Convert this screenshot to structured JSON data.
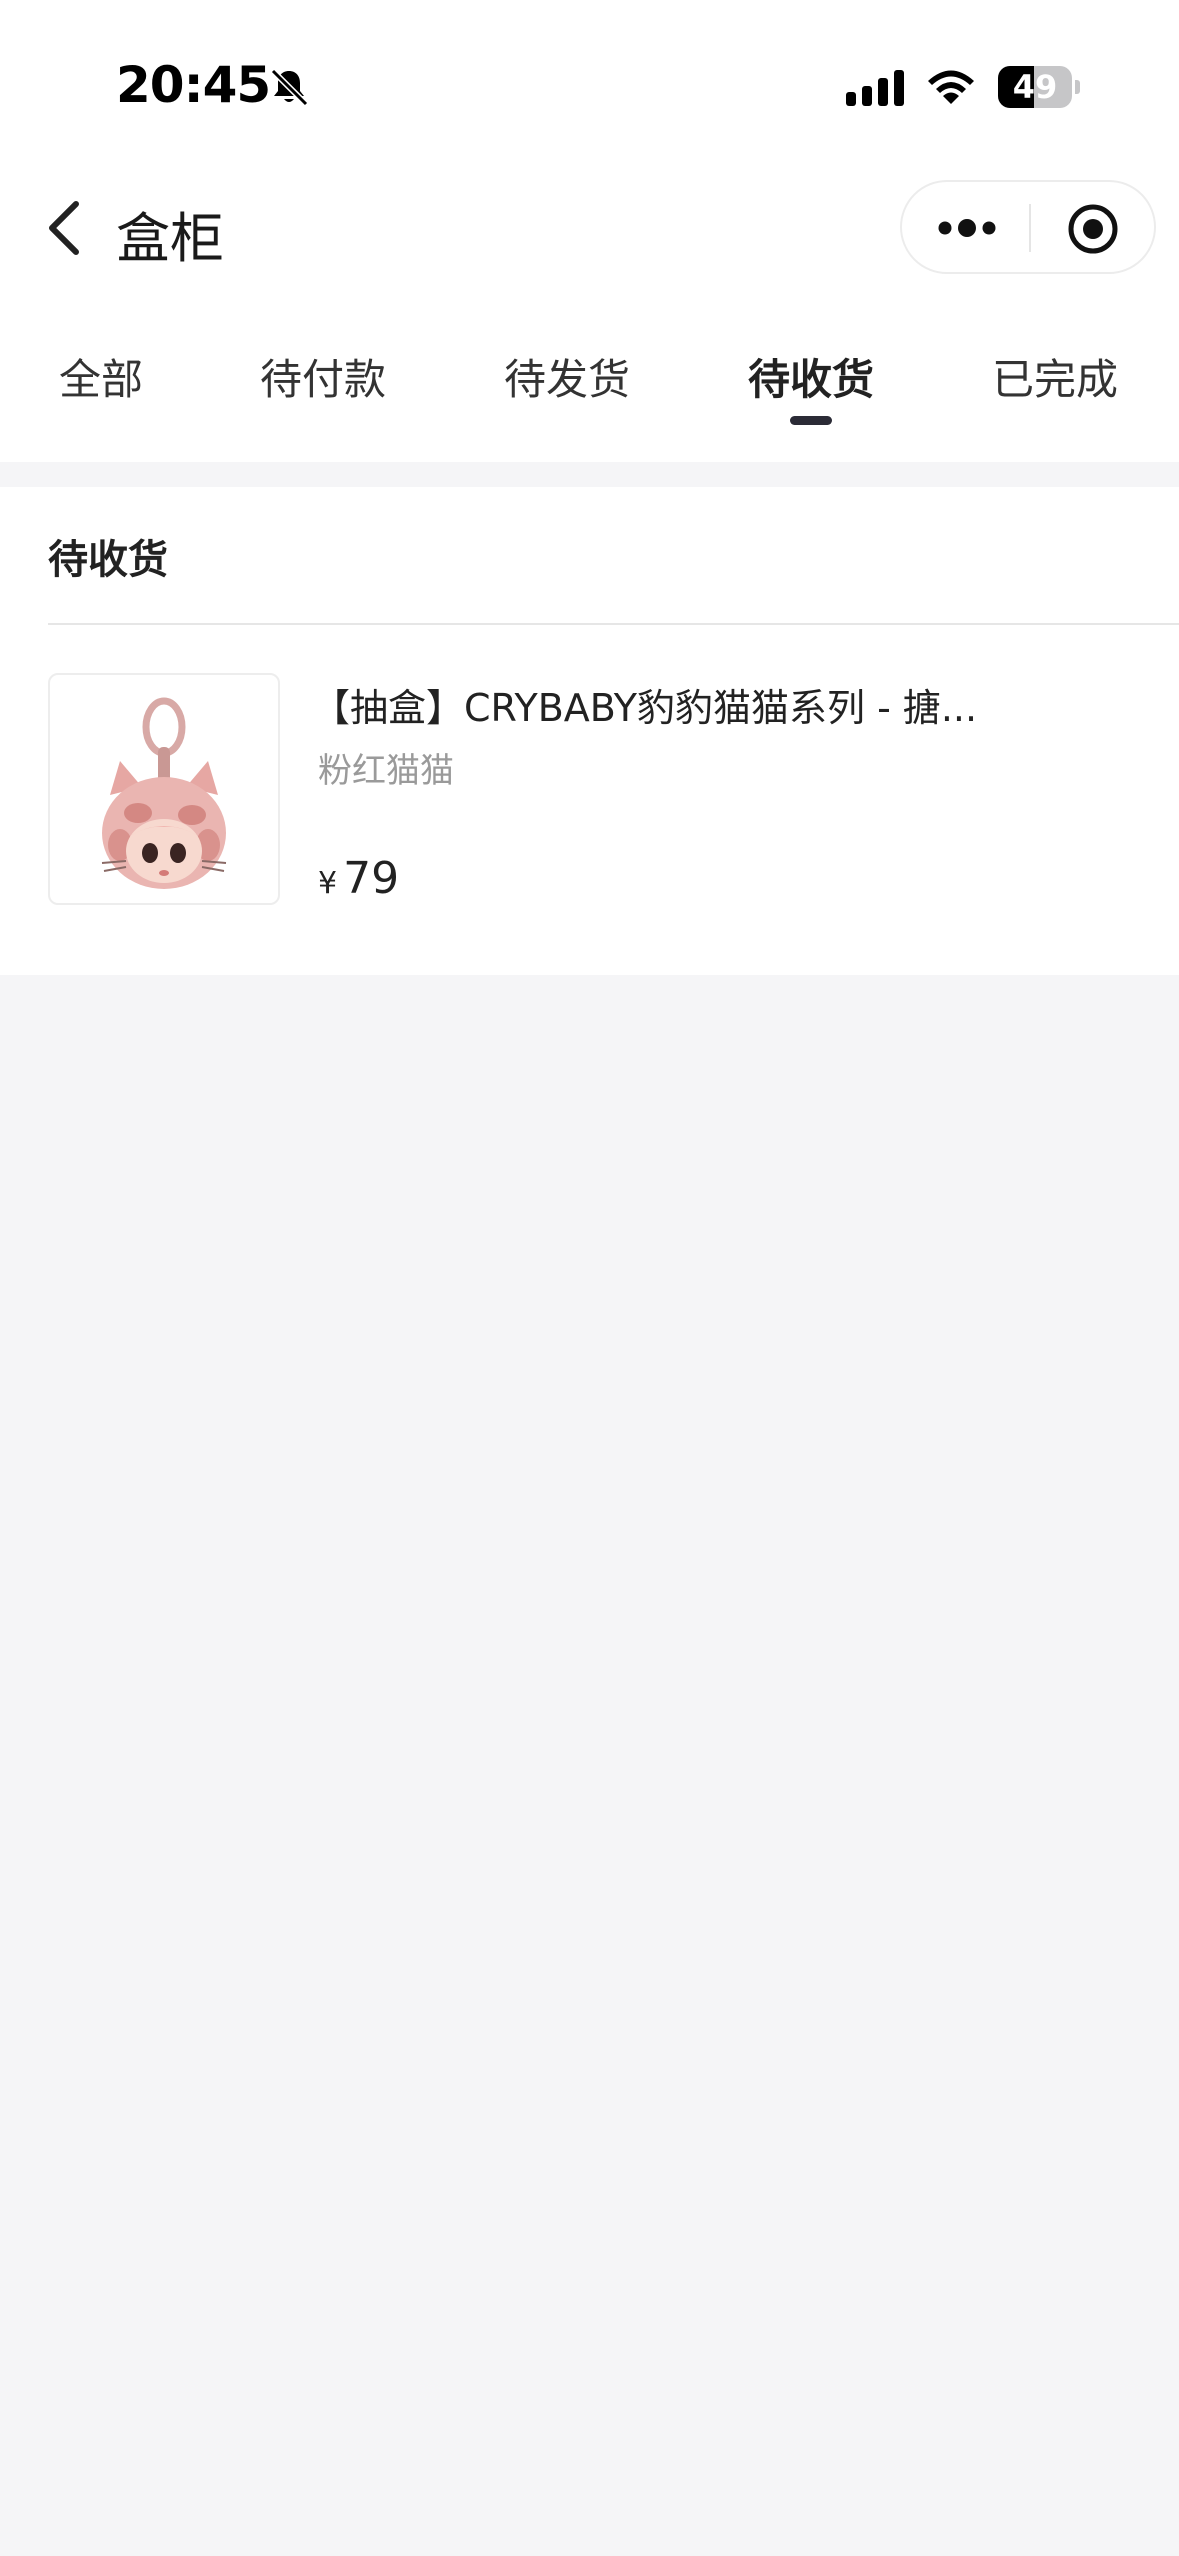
{
  "status_bar": {
    "time": "20:45",
    "battery_percent": 49,
    "battery_label": "49"
  },
  "nav": {
    "title": "盒柜"
  },
  "tabs": [
    {
      "label": "全部",
      "active": false
    },
    {
      "label": "待付款",
      "active": false
    },
    {
      "label": "待发货",
      "active": false
    },
    {
      "label": "待收货",
      "active": true
    },
    {
      "label": "已完成",
      "active": false
    }
  ],
  "section": {
    "header": "待收货",
    "items": [
      {
        "title": "【抽盒】CRYBABY豹豹猫猫系列 - 搪...",
        "variant": "粉红猫猫",
        "currency": "¥",
        "price": "79"
      }
    ]
  },
  "colors": {
    "page_background": "#f5f5f7",
    "active_tab_indicator": "#2b2b36",
    "secondary_text": "#9a9a9a"
  },
  "icons": {
    "back": "chevron-left-icon",
    "more": "more-dots-icon",
    "close": "target-close-icon",
    "bell": "bell-slash-icon",
    "signal": "cellular-signal-icon",
    "wifi": "wifi-icon"
  }
}
